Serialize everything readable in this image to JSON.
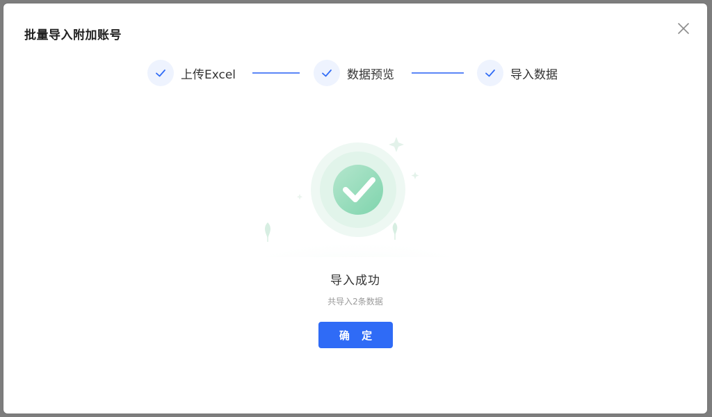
{
  "dialog": {
    "title": "批量导入附加账号",
    "close_icon": "close-icon"
  },
  "steps": [
    {
      "label": "上传Excel",
      "status": "done",
      "icon": "check-icon"
    },
    {
      "label": "数据预览",
      "status": "done",
      "icon": "check-icon"
    },
    {
      "label": "导入数据",
      "status": "done",
      "icon": "check-icon"
    }
  ],
  "result": {
    "icon": "success-check-icon",
    "title": "导入成功",
    "subtitle": "共导入2条数据"
  },
  "actions": {
    "confirm_label": "确 定"
  },
  "colors": {
    "primary": "#2f6bf6",
    "step_line": "#5b86f7",
    "step_circle_bg": "#eef3fe",
    "success": "#5cc89a"
  }
}
